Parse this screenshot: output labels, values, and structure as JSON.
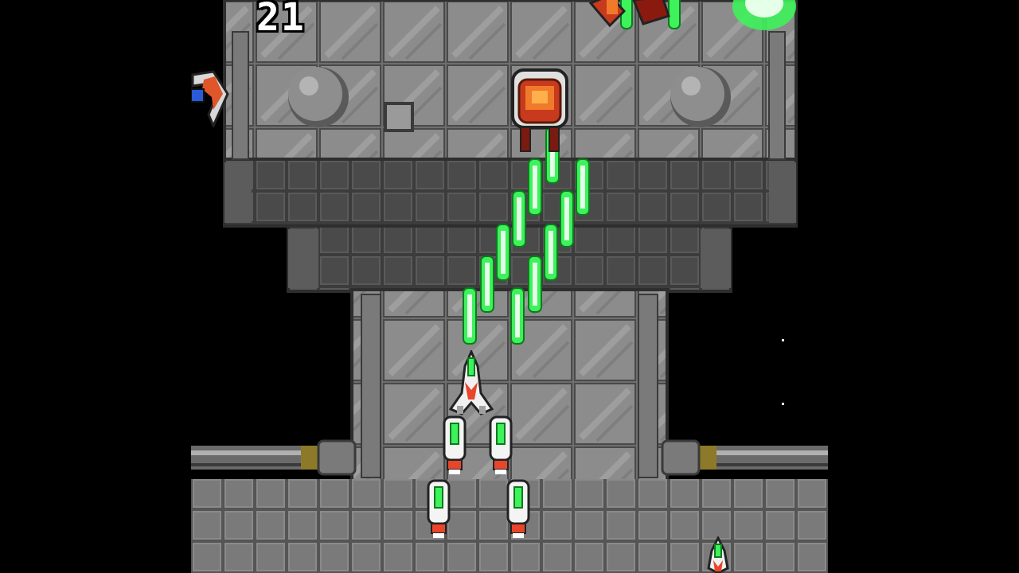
{
  "hud": {
    "score": "21"
  },
  "colors": {
    "background": "#000000",
    "hull": "#8a8a8a",
    "hull_dark": "#4a4a4a",
    "laser": "#3df25a",
    "ship_accent": "#e8452a"
  },
  "entities": {
    "player_ship": "player-fighter-icon",
    "wingmen": [
      "option-pod-icon",
      "option-pod-icon",
      "option-pod-icon",
      "option-pod-icon"
    ],
    "enemies": [
      "orange-turret-icon",
      "orange-drone-icon",
      "red-fighter-icon"
    ],
    "projectiles": "green-laser-icon"
  }
}
